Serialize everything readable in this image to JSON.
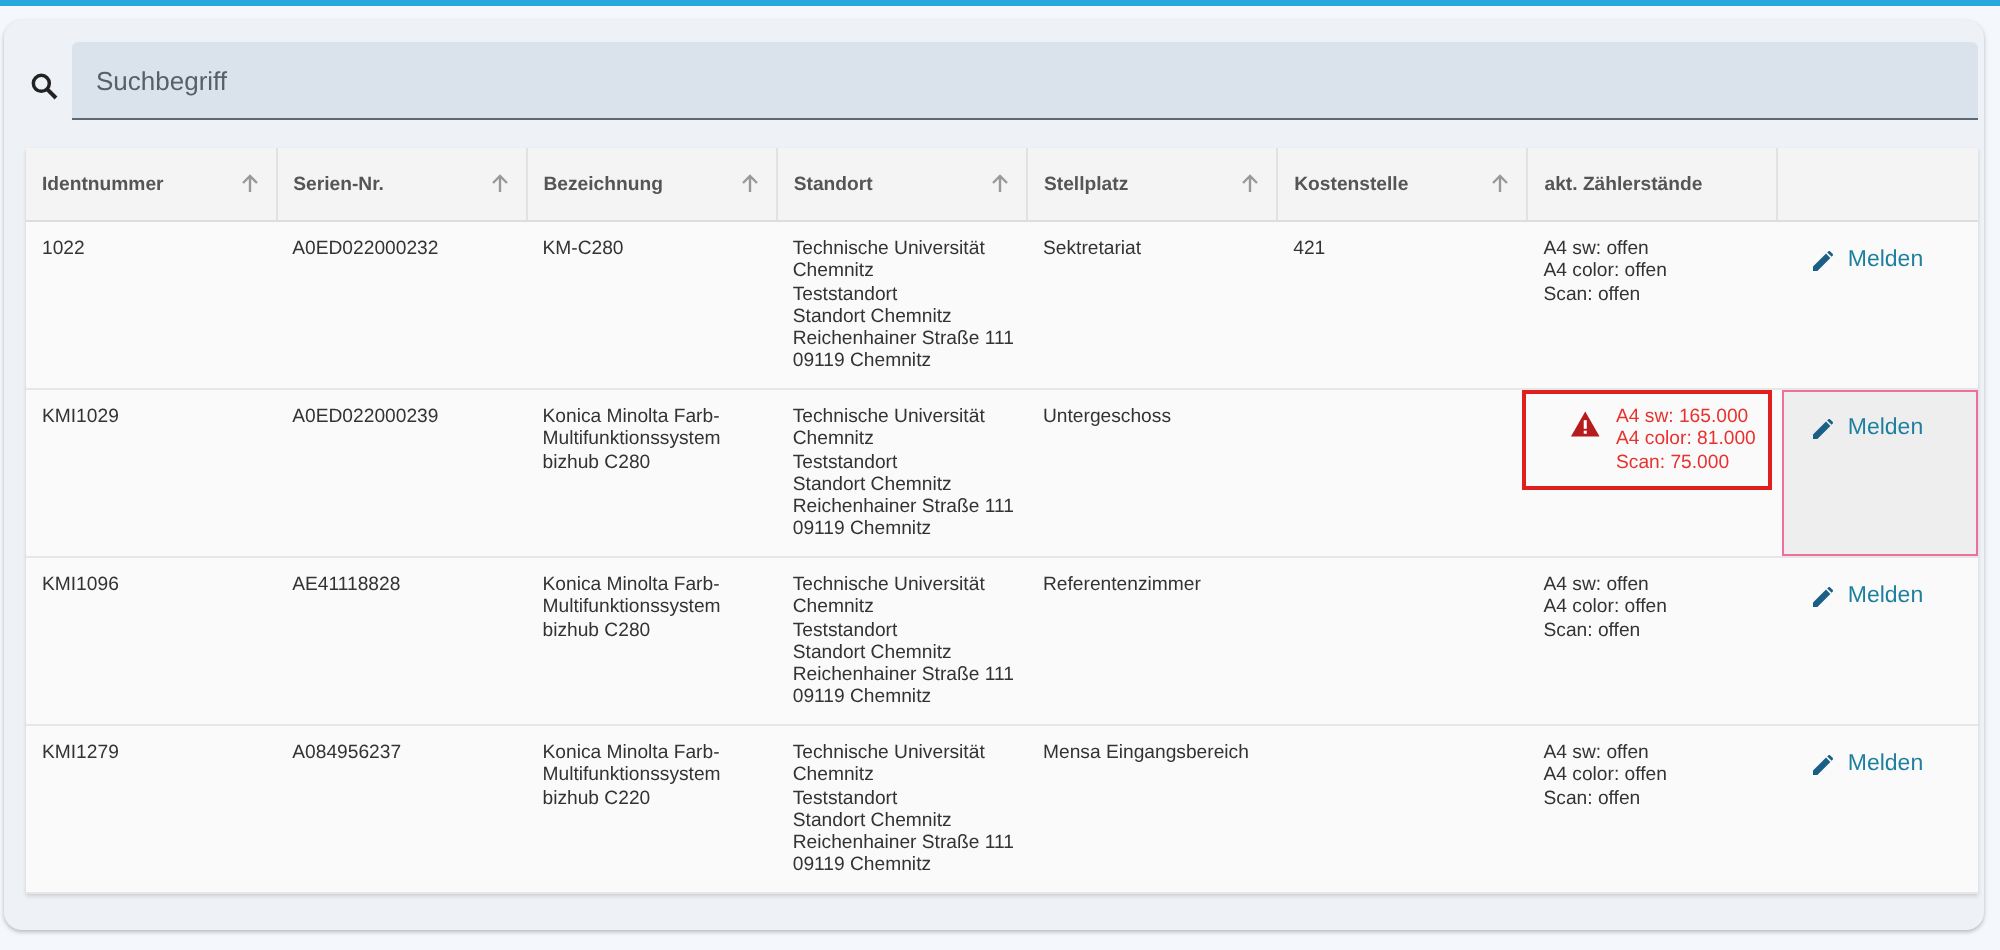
{
  "search": {
    "placeholder": "Suchbegriff"
  },
  "table": {
    "columns": [
      {
        "label": "Identnummer",
        "sortable": true
      },
      {
        "label": "Serien-Nr.",
        "sortable": true
      },
      {
        "label": "Bezeichnung",
        "sortable": true
      },
      {
        "label": "Standort",
        "sortable": true
      },
      {
        "label": "Stellplatz",
        "sortable": true
      },
      {
        "label": "Kostenstelle",
        "sortable": true
      },
      {
        "label": "akt. Zählerstände",
        "sortable": false
      },
      {
        "sortable": false
      }
    ],
    "rows": [
      {
        "identnummer": "1022",
        "serien_nr": "A0ED022000232",
        "bezeichnung": "KM-C280",
        "standort": [
          "Technische Universität Chemnitz",
          "Teststandort",
          "Standort Chemnitz",
          "Reichenhainer Straße 111",
          "09119 Chemnitz"
        ],
        "stellplatz": "Sektretariat",
        "kostenstelle": "421",
        "zaehlerstaende": [
          "A4 sw: offen",
          "A4 color: offen",
          "Scan: offen"
        ],
        "alert": false,
        "action": {
          "label": "Melden",
          "highlighted": false
        }
      },
      {
        "identnummer": "KMI1029",
        "serien_nr": "A0ED022000239",
        "bezeichnung": "Konica Minolta Farb-Multifunktionssystem bizhub C280",
        "standort": [
          "Technische Universität Chemnitz",
          "Teststandort",
          "Standort Chemnitz",
          "Reichenhainer Straße 111",
          "09119 Chemnitz"
        ],
        "stellplatz": "Untergeschoss",
        "kostenstelle": "",
        "zaehlerstaende": [
          "A4 sw: 165.000",
          "A4 color: 81.000",
          "Scan: 75.000"
        ],
        "alert": true,
        "action": {
          "label": "Melden",
          "highlighted": true
        }
      },
      {
        "identnummer": "KMI1096",
        "serien_nr": "AE41118828",
        "bezeichnung": "Konica Minolta Farb-Multifunktionssystem bizhub C280",
        "standort": [
          "Technische Universität Chemnitz",
          "Teststandort",
          "Standort Chemnitz",
          "Reichenhainer Straße 111",
          "09119 Chemnitz"
        ],
        "stellplatz": "Referentenzimmer",
        "kostenstelle": "",
        "zaehlerstaende": [
          "A4 sw: offen",
          "A4 color: offen",
          "Scan: offen"
        ],
        "alert": false,
        "action": {
          "label": "Melden",
          "highlighted": false
        }
      },
      {
        "identnummer": "KMI1279",
        "serien_nr": "A084956237",
        "bezeichnung": "Konica Minolta Farb-Multifunktionssystem bizhub C220",
        "standort": [
          "Technische Universität Chemnitz",
          "Teststandort",
          "Standort Chemnitz",
          "Reichenhainer Straße 111",
          "09119 Chemnitz"
        ],
        "stellplatz": "Mensa Eingangsbereich",
        "kostenstelle": "",
        "zaehlerstaende": [
          "A4 sw: offen",
          "A4 color: offen",
          "Scan: offen"
        ],
        "alert": false,
        "action": {
          "label": "Melden",
          "highlighted": false
        }
      }
    ]
  }
}
